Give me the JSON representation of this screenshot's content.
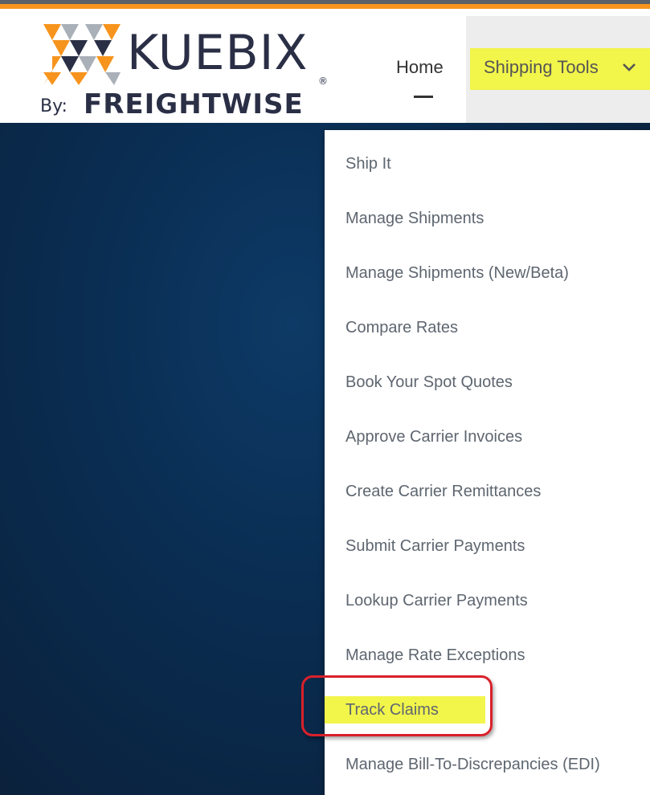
{
  "brand": {
    "name": "KUEBIX",
    "registered": "®",
    "by": "By:",
    "company": "FREIGHTWISE"
  },
  "nav": {
    "home": "Home",
    "shipping_tools": "Shipping Tools"
  },
  "colors": {
    "accent_yellow": "#f2f54a",
    "stripe_orange": "#f7941d",
    "callout_red": "#d9212a",
    "hero_navy": "#0b2a4a"
  },
  "dropdown": {
    "items": [
      {
        "label": "Ship It"
      },
      {
        "label": "Manage Shipments"
      },
      {
        "label": "Manage Shipments (New/Beta)"
      },
      {
        "label": "Compare Rates"
      },
      {
        "label": "Book Your Spot Quotes"
      },
      {
        "label": "Approve Carrier Invoices"
      },
      {
        "label": "Create Carrier Remittances"
      },
      {
        "label": "Submit Carrier Payments"
      },
      {
        "label": "Lookup Carrier Payments"
      },
      {
        "label": "Manage Rate Exceptions"
      },
      {
        "label": "Track Claims",
        "highlighted": true
      },
      {
        "label": "Manage Bill-To-Discrepancies (EDI)"
      }
    ]
  },
  "icons": {
    "chevron": "chevron-down-icon",
    "logo_mark": "kuebix-logo-icon"
  }
}
